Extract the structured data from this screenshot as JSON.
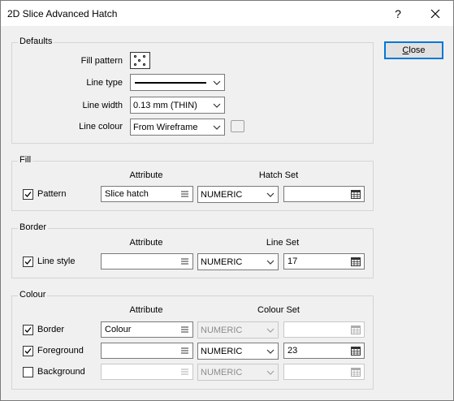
{
  "window": {
    "title": "2D Slice Advanced Hatch",
    "help_glyph": "?"
  },
  "buttons": {
    "close_label_first": "C",
    "close_label_rest": "lose"
  },
  "defaults": {
    "group_label": "Defaults",
    "fill_pattern_label": "Fill pattern",
    "line_type_label": "Line type",
    "line_width_label": "Line width",
    "line_width_value": "0.13 mm (THIN)",
    "line_colour_label": "Line colour",
    "line_colour_value": "From Wireframe"
  },
  "fill": {
    "group_label": "Fill",
    "attribute_header": "Attribute",
    "set_header": "Hatch Set",
    "rows": [
      {
        "label": "Pattern",
        "checked": true,
        "attribute": "Slice hatch",
        "type": "NUMERIC",
        "set": "",
        "enabled": true
      }
    ]
  },
  "border": {
    "group_label": "Border",
    "attribute_header": "Attribute",
    "set_header": "Line Set",
    "rows": [
      {
        "label": "Line style",
        "checked": true,
        "attribute": "",
        "type": "NUMERIC",
        "set": "17",
        "enabled": true
      }
    ]
  },
  "colour": {
    "group_label": "Colour",
    "attribute_header": "Attribute",
    "set_header": "Colour Set",
    "rows": [
      {
        "label": "Border",
        "checked": true,
        "attribute": "Colour",
        "type": "NUMERIC",
        "set": "",
        "enabled": false
      },
      {
        "label": "Foreground",
        "checked": true,
        "attribute": "",
        "type": "NUMERIC",
        "set": "23",
        "enabled": true
      },
      {
        "label": "Background",
        "checked": false,
        "attribute": "",
        "type": "NUMERIC",
        "set": "",
        "enabled": false
      }
    ]
  },
  "icons": {
    "dropdown": "chevron-down-icon",
    "field_picker": "list-icon",
    "set_picker": "grid-icon",
    "check": "check-icon"
  }
}
